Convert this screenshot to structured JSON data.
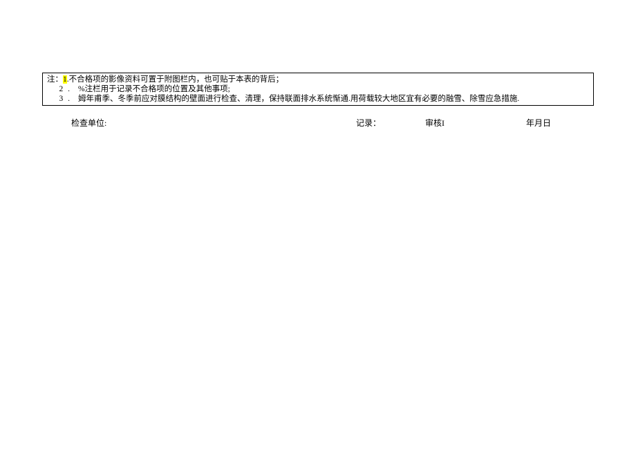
{
  "notes": {
    "prefix": "注：",
    "items": [
      {
        "num_pre_hl": "1",
        "num_post": ".",
        "text": "不合格项的影像资料可置于附图栏内，也可贴于本表的背后；",
        "highlight_num": true
      },
      {
        "num": "2",
        "sep": " .",
        "text": "%注栏用于记录不合格项的位置及其他事项;"
      },
      {
        "num": "3",
        "sep": " .",
        "text": "姆年甫季、冬季前应对膜结构的壁面进行检查、清理，保持联面排水系统惭通.用荷载较大地区宜有必要的融雪、除雪应急措施."
      }
    ]
  },
  "signatures": {
    "unit": "检查单位:",
    "record": "记录：",
    "audit_label": "审核",
    "audit_mark": "I",
    "date": "年月日"
  }
}
